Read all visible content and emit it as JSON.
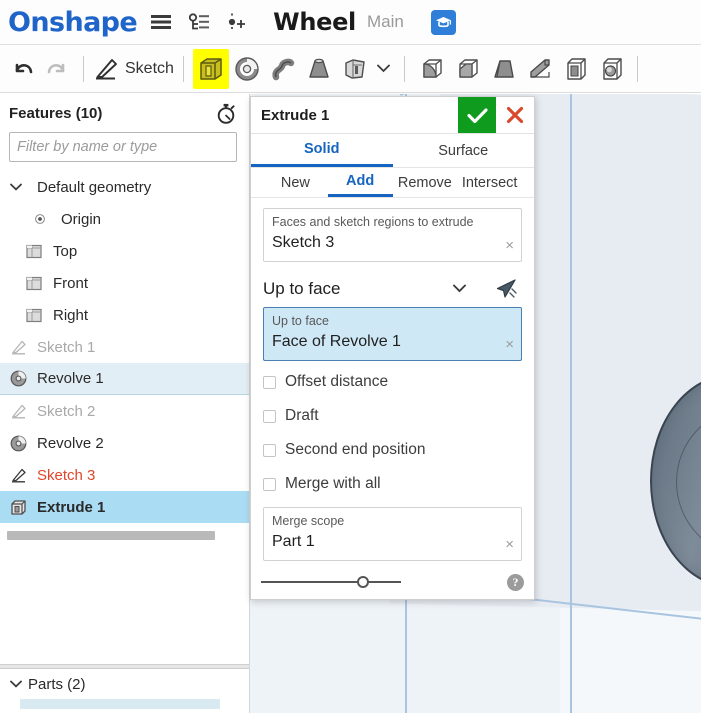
{
  "header": {
    "brand": "Onshape",
    "document_title": "Wheel",
    "workspace": "Main",
    "icons": {
      "menu": "hamburger-menu-icon",
      "versions": "version-graph-icon",
      "add_version": "add-version-icon",
      "learning": "graduation-cap-icon"
    }
  },
  "toolbar": {
    "undo_label": "undo-icon",
    "redo_label": "redo-icon",
    "sketch_label": "Sketch",
    "tools": [
      {
        "name": "extrude",
        "icon": "extrude-icon",
        "highlighted": true
      },
      {
        "name": "revolve",
        "icon": "revolve-icon",
        "highlighted": false
      },
      {
        "name": "sweep",
        "icon": "sweep-icon",
        "highlighted": false
      },
      {
        "name": "loft",
        "icon": "loft-icon",
        "highlighted": false
      },
      {
        "name": "more-shape-tools",
        "icon": "thicken-icon",
        "highlighted": false
      },
      {
        "name": "shape-dropdown",
        "icon": "chevron-down-icon",
        "highlighted": false
      },
      {
        "name": "fillet",
        "icon": "fillet-icon",
        "highlighted": false
      },
      {
        "name": "chamfer",
        "icon": "chamfer-icon",
        "highlighted": false
      },
      {
        "name": "draft",
        "icon": "draft-icon",
        "highlighted": false
      },
      {
        "name": "rib",
        "icon": "rib-icon",
        "highlighted": false
      },
      {
        "name": "shell",
        "icon": "shell-icon",
        "highlighted": false
      },
      {
        "name": "hole",
        "icon": "hole-icon",
        "highlighted": false
      }
    ]
  },
  "features_panel": {
    "title": "Features (10)",
    "rollback_icon": "stopwatch-icon",
    "filter_placeholder": "Filter by name or type",
    "filter_value": "",
    "tree": [
      {
        "label": "Default geometry",
        "icon": "chevron-down-icon",
        "indent": 0,
        "state": "normal"
      },
      {
        "label": "Origin",
        "icon": "origin-icon",
        "indent": 2,
        "state": "normal"
      },
      {
        "label": "Top",
        "icon": "plane-icon",
        "indent": 1,
        "state": "normal"
      },
      {
        "label": "Front",
        "icon": "plane-icon",
        "indent": 1,
        "state": "normal"
      },
      {
        "label": "Right",
        "icon": "plane-icon",
        "indent": 1,
        "state": "normal"
      },
      {
        "label": "Sketch 1",
        "icon": "sketch-icon",
        "indent": 0,
        "state": "suppressed"
      },
      {
        "label": "Revolve 1",
        "icon": "revolve-icon",
        "indent": 0,
        "state": "hover"
      },
      {
        "label": "Sketch 2",
        "icon": "sketch-icon",
        "indent": 0,
        "state": "suppressed"
      },
      {
        "label": "Revolve 2",
        "icon": "revolve-icon",
        "indent": 0,
        "state": "normal"
      },
      {
        "label": "Sketch 3",
        "icon": "sketch-icon",
        "indent": 0,
        "state": "error"
      },
      {
        "label": "Extrude 1",
        "icon": "extrude-icon",
        "indent": 0,
        "state": "selected"
      }
    ]
  },
  "parts_panel": {
    "title": "Parts (2)",
    "expand_icon": "chevron-down-icon"
  },
  "extrude_dialog": {
    "title": "Extrude 1",
    "accept_label": "✓",
    "cancel_label": "✕",
    "accept_color": "#0f9c1e",
    "cancel_color": "#d9482a",
    "accent_color": "#1565c0",
    "type_tabs": [
      {
        "label": "Solid",
        "active": true
      },
      {
        "label": "Surface",
        "active": false
      }
    ],
    "operation_tabs": [
      {
        "label": "New",
        "active": false
      },
      {
        "label": "Add",
        "active": true
      },
      {
        "label": "Remove",
        "active": false
      },
      {
        "label": "Intersect",
        "active": false
      }
    ],
    "faces_field": {
      "label": "Faces and sketch regions to extrude",
      "value": "Sketch 3",
      "clear": "×"
    },
    "end_condition": {
      "value": "Up to face",
      "caret": "▾",
      "flip_icon": "flip-direction-arrow-icon"
    },
    "up_to_face_field": {
      "label": "Up to face",
      "value": "Face of Revolve 1",
      "clear": "×",
      "focused": true,
      "focus_bg": "#cfe8f6"
    },
    "checkboxes": [
      {
        "label": "Offset distance",
        "checked": false
      },
      {
        "label": "Draft",
        "checked": false
      },
      {
        "label": "Second end position",
        "checked": false
      },
      {
        "label": "Merge with all",
        "checked": false
      }
    ],
    "merge_scope_field": {
      "label": "Merge scope",
      "value": "Part 1",
      "clear": "×"
    },
    "opacity_slider": {
      "name": "opacity-slider",
      "position_percent": 70
    },
    "help_label": "?"
  },
  "viewport": {
    "name": "3d-viewport",
    "background": "#f4f8fa",
    "plane_color": "#e7ecf2",
    "sketch_line_color": "#a9c4e0",
    "part_color": "#6b7a89"
  }
}
